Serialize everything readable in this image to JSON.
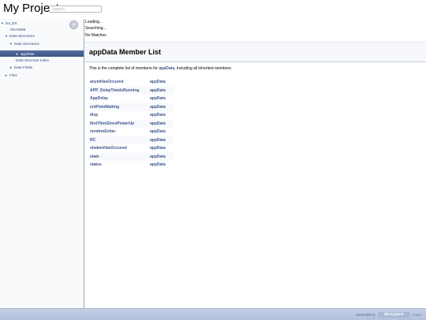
{
  "header": {
    "project_name": "My Project",
    "search_placeholder": "Search"
  },
  "sidebar": {
    "items": [
      {
        "label": "Da_ES",
        "arrow": "▼"
      },
      {
        "label": "README",
        "arrow": ""
      },
      {
        "label": "Data Structures",
        "arrow": "▼"
      },
      {
        "label": "Data Structures",
        "arrow": "▼"
      },
      {
        "label": "appData",
        "arrow": "►"
      },
      {
        "label": "Data Structure Index",
        "arrow": ""
      },
      {
        "label": "Data Fields",
        "arrow": "►"
      },
      {
        "label": "Files",
        "arrow": "►"
      }
    ]
  },
  "search_status": {
    "loading": "Loading...",
    "searching": "Searching...",
    "no_matches": "No Matches"
  },
  "main": {
    "title": "appData Member List",
    "intro_prefix": "This is the complete list of members for ",
    "intro_link": "appData",
    "intro_suffix": ", including all inherited members.",
    "members": [
      {
        "name": "anymHasOccured",
        "class": "appData"
      },
      {
        "name": "APP_DelayTimeIsRunning",
        "class": "appData"
      },
      {
        "name": "AppDelay",
        "class": "appData"
      },
      {
        "name": "cntPwmWaiting",
        "class": "appData"
      },
      {
        "name": "disp",
        "class": "appData"
      },
      {
        "name": "firstTimeSincePowerUp",
        "class": "appData"
      },
      {
        "name": "nombreEntier",
        "class": "appData"
      },
      {
        "name": "RC",
        "class": "appData"
      },
      {
        "name": "shakenHasOccured",
        "class": "appData"
      },
      {
        "name": "state",
        "class": "appData"
      },
      {
        "name": "status",
        "class": "appData"
      }
    ]
  },
  "footer": {
    "generated_by": "Generated by",
    "logo_text": "doxygen",
    "version": "1.13.2"
  },
  "colors": {
    "link": "#3d578c",
    "nav_selected": "#3d5485",
    "footer_bg": "#c5cfe4"
  },
  "icons": {
    "sync": "sync-icon"
  }
}
